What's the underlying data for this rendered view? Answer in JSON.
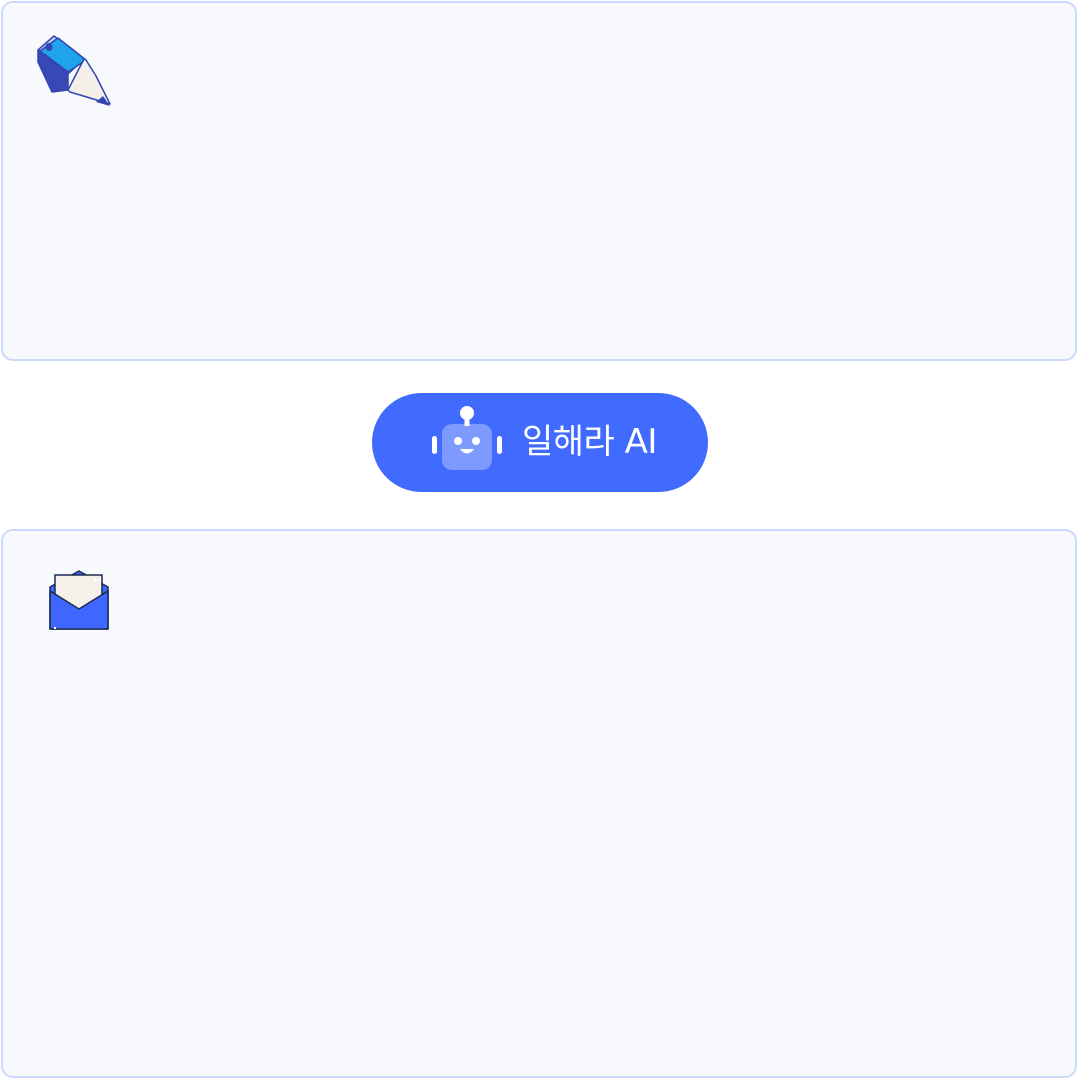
{
  "colors": {
    "accent": "#416bff",
    "panel_background": "#f7f9fd",
    "panel_border": "#cbd9fc"
  },
  "input_panel": {
    "icon": "pencil-icon",
    "text": ""
  },
  "ai_button": {
    "icon": "robot-icon",
    "label": "일해라 AI"
  },
  "output_panel": {
    "icon": "envelope-icon",
    "text": ""
  }
}
